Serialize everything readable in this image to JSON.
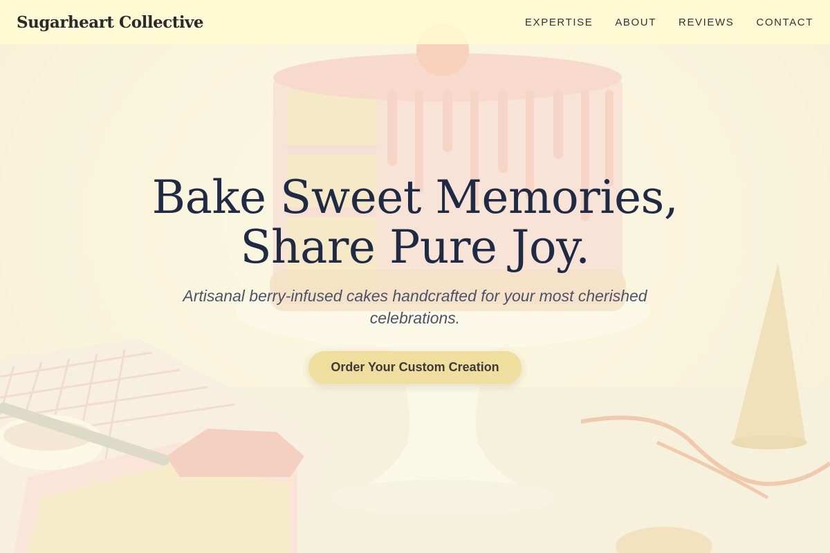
{
  "brand": {
    "name": "Sugarheart Collective"
  },
  "nav": {
    "items": [
      {
        "label": "EXPERTISE"
      },
      {
        "label": "ABOUT"
      },
      {
        "label": "REVIEWS"
      },
      {
        "label": "CONTACT"
      }
    ]
  },
  "hero": {
    "headline_line1": "Bake Sweet Memories,",
    "headline_line2": "Share Pure Joy.",
    "subheadline": "Artisanal berry-infused cakes handcrafted for your most cherished celebrations.",
    "cta_label": "Order Your Custom Creation",
    "background_image": "drip-cake-photo"
  },
  "colors": {
    "navbar_bg": "#fffbd2",
    "headline": "#1f2a44",
    "subheadline": "#4a5468",
    "cta_bg": "#f0de9e",
    "cta_text": "#3a3a3a"
  }
}
